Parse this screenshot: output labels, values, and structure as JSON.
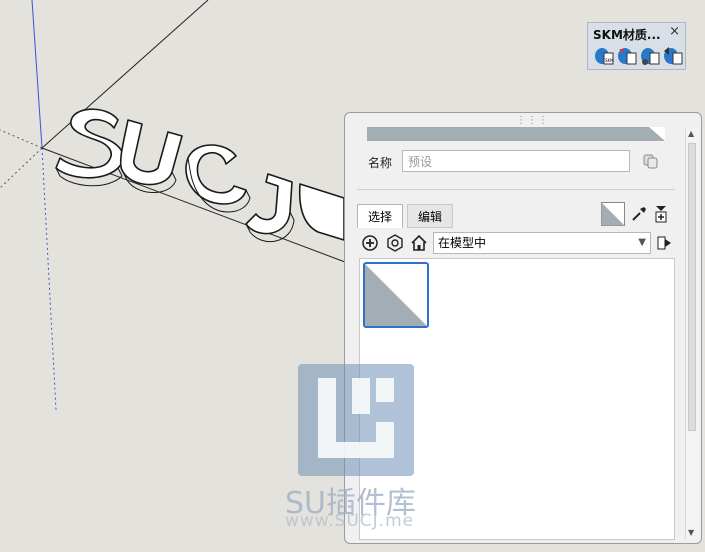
{
  "toolbar": {
    "title": "SKM材质...",
    "close": "×",
    "buttons": [
      "skm-material-1-icon",
      "skm-material-2-icon",
      "skm-material-3-icon",
      "skm-material-4-icon"
    ]
  },
  "panel": {
    "name_label": "名称",
    "name_placeholder": "预设",
    "tabs": [
      {
        "label": "选择",
        "active": true
      },
      {
        "label": "编辑",
        "active": false
      }
    ],
    "library_dropdown": "在模型中",
    "material_color": "#a2adb4",
    "selection_color": "#2f73c8"
  },
  "watermark": {
    "text": "SU插件库",
    "url": "www.SUCJ.me"
  }
}
